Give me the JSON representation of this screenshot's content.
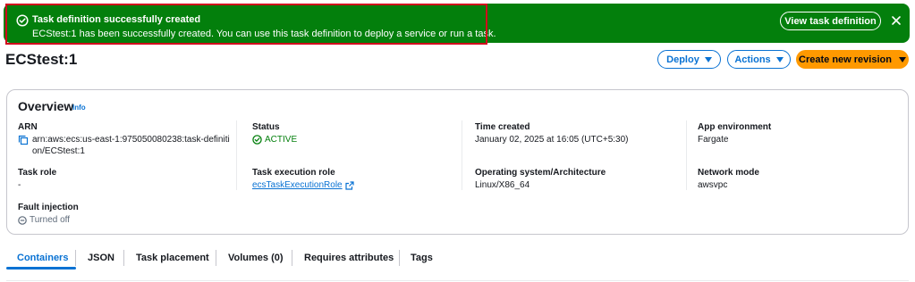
{
  "flash": {
    "title": "Task definition successfully created",
    "message": "ECStest:1 has been successfully created. You can use this task definition to deploy a service or run a task.",
    "view_button": "View task definition",
    "color": "#037f0c"
  },
  "header": {
    "title": "ECStest:1",
    "deploy_label": "Deploy",
    "actions_label": "Actions",
    "create_revision_label": "Create new revision"
  },
  "overview": {
    "title": "Overview",
    "info_label": "Info",
    "arn": {
      "label": "ARN",
      "value_line1": "arn:aws:ecs:us-east-1:975050080238:task-definiti",
      "value_line2": "on/ECStest:1"
    },
    "status": {
      "label": "Status",
      "value": "ACTIVE"
    },
    "time_created": {
      "label": "Time created",
      "value": "January 02, 2025 at 16:05 (UTC+5:30)"
    },
    "app_environment": {
      "label": "App environment",
      "value": "Fargate"
    },
    "task_role": {
      "label": "Task role",
      "value": "-"
    },
    "task_execution_role": {
      "label": "Task execution role",
      "value": "ecsTaskExecutionRole"
    },
    "os_arch": {
      "label": "Operating system/Architecture",
      "value": "Linux/X86_64"
    },
    "network_mode": {
      "label": "Network mode",
      "value": "awsvpc"
    },
    "fault_injection": {
      "label": "Fault injection",
      "value": "Turned off"
    }
  },
  "tabs": [
    {
      "label": "Containers",
      "active": true
    },
    {
      "label": "JSON"
    },
    {
      "label": "Task placement"
    },
    {
      "label": "Volumes (0)"
    },
    {
      "label": "Requires attributes"
    },
    {
      "label": "Tags"
    }
  ],
  "colors": {
    "link": "#0972d3",
    "primary": "#ff9900",
    "success": "#037f0c"
  }
}
